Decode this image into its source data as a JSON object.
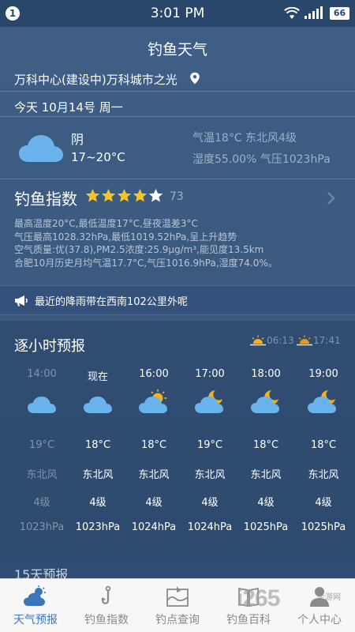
{
  "status_bar": {
    "notification_count": "1",
    "time": "3:01 PM",
    "battery": "66"
  },
  "app": {
    "title": "钓鱼天气"
  },
  "location": {
    "name": "万科中心(建设中)万科城市之光"
  },
  "today": {
    "date": "今天 10月14号 周一",
    "condition": "阴",
    "temp_range": "17~20°C",
    "temp_wind": "气温18°C 东北风4级",
    "humidity_pressure": "湿度55.00% 气压1023hPa"
  },
  "fishing_index": {
    "title": "钓鱼指数",
    "stars_filled": 4,
    "stars_total": 5,
    "score": "73",
    "lines": [
      "最高温度20°C,最低温度17°C,昼夜温差3°C",
      "气压最高1028.32hPa,最低1019.52hPa,呈上升趋势",
      "空气质量:优(37.8),PM2.5浓度:25.9μg/m³,能见度13.5km",
      "合肥10月历史月均气温17.7°C,气压1016.9hPa,湿度74.0%。"
    ]
  },
  "rain_notice": {
    "text": "最近的降雨带在西南102公里外呢"
  },
  "hourly": {
    "title": "逐小时预报",
    "sunrise": "06:13",
    "sunset": "17:41",
    "columns": [
      {
        "time": "14:00",
        "icon": "cloud-icon",
        "temp": "19°C",
        "wind": "东北风",
        "level": "4级",
        "pressure": "1023hPa",
        "past": true
      },
      {
        "time": "现在",
        "icon": "cloud-icon",
        "temp": "18°C",
        "wind": "东北风",
        "level": "4级",
        "pressure": "1023hPa",
        "past": false
      },
      {
        "time": "16:00",
        "icon": "sun-cloud-icon",
        "temp": "18°C",
        "wind": "东北风",
        "level": "4级",
        "pressure": "1024hPa",
        "past": false
      },
      {
        "time": "17:00",
        "icon": "moon-cloud-icon",
        "temp": "19°C",
        "wind": "东北风",
        "level": "4级",
        "pressure": "1024hPa",
        "past": false
      },
      {
        "time": "18:00",
        "icon": "moon-cloud-icon",
        "temp": "18°C",
        "wind": "东北风",
        "level": "4级",
        "pressure": "1025hPa",
        "past": false
      },
      {
        "time": "19:00",
        "icon": "moon-cloud-icon",
        "temp": "18°C",
        "wind": "东北风",
        "level": "4级",
        "pressure": "1025hPa",
        "past": false
      }
    ]
  },
  "forecast15": {
    "label": "15天预报"
  },
  "tabs": [
    {
      "label": "天气预报",
      "icon": "weather-icon",
      "active": true
    },
    {
      "label": "钓鱼指数",
      "icon": "hook-icon",
      "active": false
    },
    {
      "label": "钓点查询",
      "icon": "spot-icon",
      "active": false
    },
    {
      "label": "钓鱼百科",
      "icon": "book-icon",
      "active": false
    },
    {
      "label": "个人中心",
      "icon": "user-icon",
      "active": false
    }
  ],
  "watermark": {
    "text": "i265",
    "sub": "手游网"
  },
  "colors": {
    "accent": "#3c76b8",
    "star": "#f7c326",
    "cloud": "#6ab3ec",
    "moon": "#f3b21b"
  }
}
